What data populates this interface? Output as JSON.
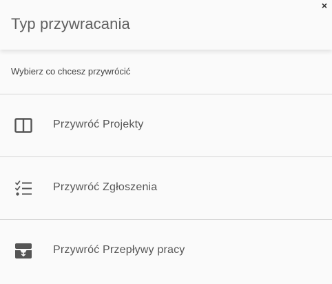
{
  "dialog": {
    "title": "Typ przywracania",
    "close_label": "×",
    "subtitle": "Wybierz co chcesz przywrócić",
    "options": [
      {
        "label": "Przywróć Projekty",
        "icon": "board-columns-icon"
      },
      {
        "label": "Przywróć Zgłoszenia",
        "icon": "checklist-icon"
      },
      {
        "label": "Przywróć Przepływy pracy",
        "icon": "workflow-tray-icon"
      }
    ]
  },
  "colors": {
    "background": "#fafafa",
    "title_text": "#616161",
    "label_text": "#555555",
    "icon": "#555555",
    "divider": "#d6d6d6"
  }
}
